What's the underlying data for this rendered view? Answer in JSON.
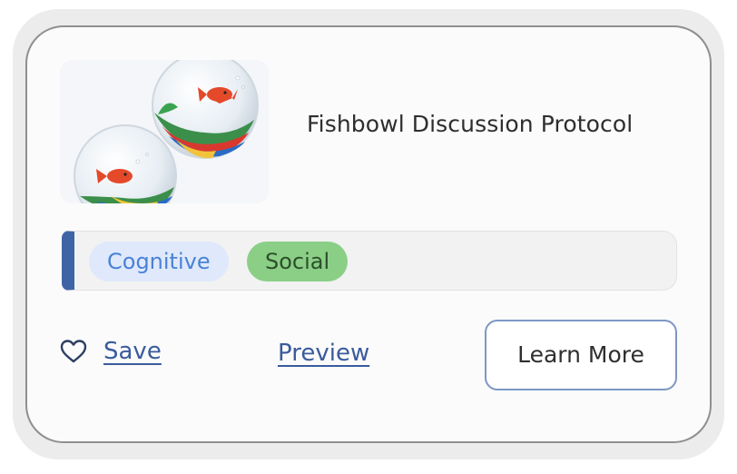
{
  "card": {
    "title": "Fishbowl Discussion Protocol",
    "image_icon": "fishbowl-image",
    "tags": [
      {
        "label": "Cognitive",
        "bg": "#dfe9fb",
        "color": "#4a82d6"
      },
      {
        "label": "Social",
        "bg": "#8bcf87",
        "color": "#2d4f2a"
      }
    ],
    "accent_color": "#3f64a6",
    "actions": {
      "save_icon": "heart-outline-icon",
      "save_label": "Save",
      "preview_label": "Preview",
      "learn_more_label": "Learn More"
    }
  }
}
